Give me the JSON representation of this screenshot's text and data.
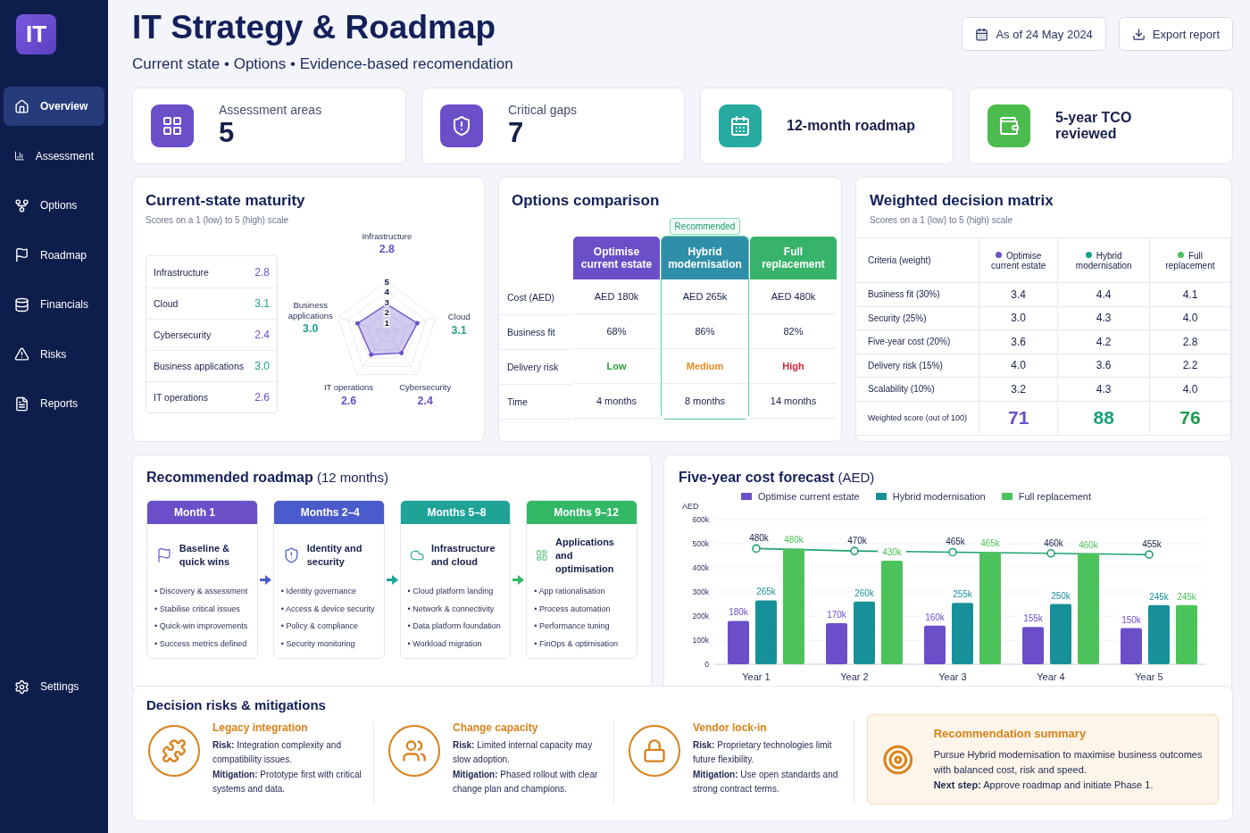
{
  "sidebar": {
    "logo": "IT",
    "items": [
      {
        "label": "Overview",
        "selected": true
      },
      {
        "label": "Assessment",
        "selected": false
      },
      {
        "label": "Options",
        "selected": false
      },
      {
        "label": "Roadmap",
        "selected": false
      },
      {
        "label": "Financials",
        "selected": false
      },
      {
        "label": "Risks",
        "selected": false
      },
      {
        "label": "Reports",
        "selected": false
      }
    ],
    "footer": {
      "label": "Settings"
    }
  },
  "header": {
    "title": "IT Strategy & Roadmap",
    "subtitle": "Current state • Options • Evidence-based recomendation",
    "date_button": "As of 24 May 2024",
    "export_button": "Export report"
  },
  "kpis": [
    {
      "label": "Assessment areas",
      "value": "5",
      "color": "#6a4fc9"
    },
    {
      "label": "Critical gaps",
      "value": "7",
      "color": "#6a4fc9"
    },
    {
      "label": "12-month roadmap",
      "color": "#27aaa0"
    },
    {
      "label": "5-year TCO reviewed",
      "color": "#4cbc4f"
    }
  ],
  "maturity": {
    "title": "Current-state maturity",
    "subtitle": "Scores on a 1 (low) to 5 (high) scale",
    "areas": [
      {
        "label": "Infrastructure",
        "value": "2.8",
        "color": "#6a4fc9"
      },
      {
        "label": "Cloud",
        "value": "3.1",
        "color": "#1f9e8c"
      },
      {
        "label": "Cybersecurity",
        "value": "2.4",
        "color": "#6a4fc9"
      },
      {
        "label": "Business applications",
        "value": "3.0",
        "color": "#1f9e8c"
      },
      {
        "label": "IT operations",
        "value": "2.6",
        "color": "#6a4fc9"
      }
    ],
    "radar": {
      "ticks": [
        "5",
        "4",
        "3",
        "2",
        "1"
      ],
      "axes": [
        {
          "label": "Infrastructure",
          "value": "2.8",
          "color": "#6a4fc9"
        },
        {
          "label": "Business applications",
          "value": "3.0",
          "color": "#1f9e8c"
        },
        {
          "label": "Cloud",
          "value": "3.1",
          "color": "#1f9e8c"
        },
        {
          "label": "IT operations",
          "value": "2.6",
          "color": "#6a4fc9"
        },
        {
          "label": "Cybersecurity",
          "value": "2.4",
          "color": "#6a4fc9"
        }
      ]
    }
  },
  "options": {
    "title": "Options comparison",
    "badge": "Recommended",
    "row_labels": [
      "Cost (AED)",
      "Business fit",
      "Delivery risk",
      "Time"
    ],
    "columns": [
      {
        "label": "Optimise current estate",
        "color": "#6a4fc9",
        "recommended": false,
        "cells": [
          {
            "text": "AED 180k"
          },
          {
            "text": "68%"
          },
          {
            "text": "Low",
            "color": "#2e9e3e"
          },
          {
            "text": "4 months"
          }
        ]
      },
      {
        "label": "Hybrid modernisation",
        "color": "#2f8fa8",
        "recommended": true,
        "cells": [
          {
            "text": "AED 265k"
          },
          {
            "text": "86%"
          },
          {
            "text": "Medium",
            "color": "#e58a1f"
          },
          {
            "text": "8 months"
          }
        ]
      },
      {
        "label": "Full replacement",
        "color": "#37b36a",
        "recommended": false,
        "cells": [
          {
            "text": "AED 480k"
          },
          {
            "text": "82%"
          },
          {
            "text": "High",
            "color": "#d9263c"
          },
          {
            "text": "14 months"
          }
        ]
      }
    ]
  },
  "matrix": {
    "title": "Weighted decision matrix",
    "subtitle": "Scores on a 1 (low) to 5 (high) scale",
    "header": "Criteria (weight)",
    "columns": [
      {
        "label": "Optimise current estate",
        "color": "#6a4fc9"
      },
      {
        "label": "Hybrid modernisation",
        "color": "#17a085"
      },
      {
        "label": "Full replacement",
        "color": "#4cc35a"
      }
    ],
    "rows": [
      {
        "label": "Business fit (30%)",
        "values": [
          "3.4",
          "4.4",
          "4.1"
        ]
      },
      {
        "label": "Security (25%)",
        "values": [
          "3.0",
          "4.3",
          "4.0"
        ]
      },
      {
        "label": "Five-year cost (20%)",
        "values": [
          "3.6",
          "4.2",
          "2.8"
        ]
      },
      {
        "label": "Delivery risk (15%)",
        "values": [
          "4.0",
          "3.6",
          "2.2"
        ]
      },
      {
        "label": "Scalability (10%)",
        "values": [
          "3.2",
          "4.3",
          "4.0"
        ]
      }
    ],
    "total": {
      "label": "Weighted score (out of 100)",
      "values": [
        {
          "text": "71",
          "color": "#6a4fc9"
        },
        {
          "text": "88",
          "color": "#17a07a"
        },
        {
          "text": "76",
          "color": "#1f9a4e"
        }
      ]
    }
  },
  "roadmap": {
    "title": "**Recommended roadmap** (12 months)",
    "bullet": "•",
    "phases": [
      {
        "period": "Month 1",
        "title": "Baseline & quick wins",
        "color": "#6a4fc9",
        "items": [
          "Discovery & assessment",
          "Stabilise critical issues",
          "Quick-win improvements",
          "Success metrics defined"
        ]
      },
      {
        "period": "Months 2–4",
        "title": "Identity and security",
        "color": "#4a5ccc",
        "items": [
          "Identity governance",
          "Access & device security",
          "Policy & compliance",
          "Security monitoring"
        ]
      },
      {
        "period": "Months 5–8",
        "title": "Infrastructure and cloud",
        "color": "#1fa397",
        "items": [
          "Cloud platform landing",
          "Network & connectivity",
          "Data platform foundation",
          "Workload migration"
        ]
      },
      {
        "period": "Months 9–12",
        "title": "Applications and optimisation",
        "color": "#33b866",
        "items": [
          "App rationalisation",
          "Process automation",
          "Performance tuning",
          "FinOps & optimisation"
        ]
      }
    ]
  },
  "forecast": {
    "title": "**Five-year cost forecast** (AED)",
    "chart_data": {
      "type": "bar",
      "ylabel": "AED",
      "categories": [
        "Year 1",
        "Year 2",
        "Year 3",
        "Year 4",
        "Year 5"
      ],
      "series": [
        {
          "name": "Optimise current estate",
          "color": "#6a4fc9",
          "values": [
            180000,
            170000,
            160000,
            155000,
            150000
          ],
          "value_labels": [
            "180k",
            "170k",
            "160k",
            "155k",
            "150k"
          ]
        },
        {
          "name": "Hybrid modernisation",
          "color": "#17909a",
          "values": [
            265000,
            260000,
            255000,
            250000,
            245000
          ],
          "value_labels": [
            "265k",
            "260k",
            "255k",
            "250k",
            "245k"
          ]
        },
        {
          "name": "Full replacement",
          "color": "#4cc35a",
          "values": [
            480000,
            430000,
            465000,
            460000,
            245000
          ],
          "value_labels": [
            "480k",
            "430k",
            "465k",
            "460k",
            "245k"
          ]
        },
        {
          "type": "line",
          "marker": "circle",
          "color": "#1fa36e",
          "values": [
            480000,
            470000,
            465000,
            460000,
            455000
          ],
          "value_labels": [
            "480k",
            "470k",
            "465k",
            "460k",
            "455k"
          ]
        }
      ],
      "grid": true,
      "ylim": [
        0,
        600000
      ],
      "yticks": [
        {
          "value": 0,
          "label": "0"
        },
        {
          "value": 100000,
          "label": "100k"
        },
        {
          "value": 200000,
          "label": "200k"
        },
        {
          "value": 300000,
          "label": "300k"
        },
        {
          "value": 400000,
          "label": "400k"
        },
        {
          "value": 500000,
          "label": "500k"
        },
        {
          "value": 600000,
          "label": "600k"
        }
      ],
      "data_labels": true
    }
  },
  "risks": {
    "title": "Decision risks & mitigations",
    "items": [
      {
        "title": "Legacy integration",
        "risk": "**Risk:** Integration complexity and compatibility issues.",
        "mitigation": "**Mitigation:** Prototype first with critical systems and data."
      },
      {
        "title": "Change capacity",
        "risk": "**Risk:** Limited internal capacity may slow adoption.",
        "mitigation": "**Mitigation:** Phased rollout with clear change plan and champions."
      },
      {
        "title": "Vendor lock-in",
        "risk": "**Risk:** Proprietary technologies limit future flexibility.",
        "mitigation": "**Mitigation:** Use open standards and strong contract terms."
      }
    ],
    "summary": {
      "title": "Recommendation summary",
      "text": "Pursue Hybrid modernisation to maximise business outcomes with balanced cost, risk and speed.",
      "next_step": "**Next step:** Approve roadmap and initiate Phase 1."
    }
  }
}
